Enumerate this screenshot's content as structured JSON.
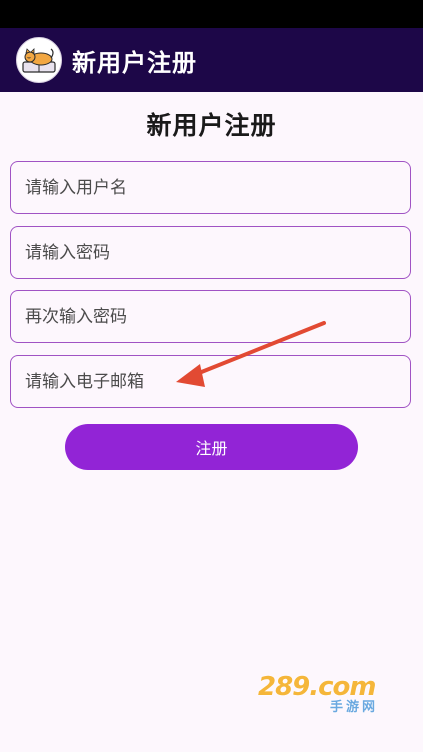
{
  "app_bar": {
    "title": "新用户注册",
    "icon": "cat-sleeping-on-book-icon"
  },
  "form": {
    "heading": "新用户注册",
    "fields": [
      {
        "placeholder": "请输入用户名",
        "value": ""
      },
      {
        "placeholder": "请输入密码",
        "value": ""
      },
      {
        "placeholder": "再次输入密码",
        "value": ""
      },
      {
        "placeholder": "请输入电子邮箱",
        "value": ""
      }
    ],
    "submit_label": "注册"
  },
  "annotation": {
    "icon": "red-arrow-icon",
    "color": "#e24a33"
  },
  "watermark": {
    "main": "289.com",
    "sub": "手游网"
  },
  "colors": {
    "app_bar": "#1d0748",
    "accent": "#9224d6",
    "field_border": "#a053c4",
    "background": "#fdf7fd"
  }
}
